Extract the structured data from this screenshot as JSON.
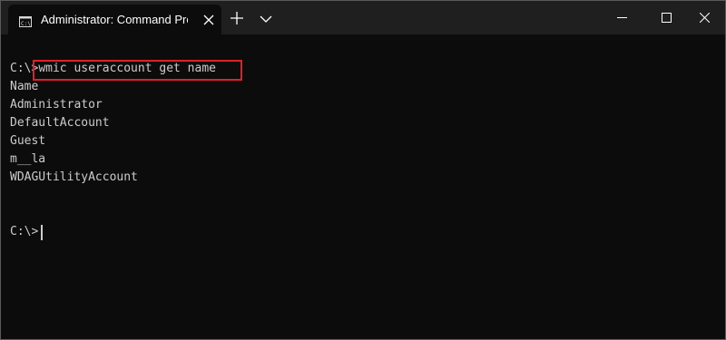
{
  "window": {
    "tab_title": "Administrator: Command Prompt",
    "icons": {
      "tab": "cmd-terminal-icon",
      "close_tab": "close-icon",
      "new_tab": "plus-icon",
      "dropdown": "chevron-down-icon",
      "minimize": "minimize-icon",
      "maximize": "maximize-icon",
      "close_window": "close-icon"
    }
  },
  "terminal": {
    "prompt": "C:\\>",
    "command": "wmic useraccount get name",
    "output_header": "Name",
    "output_rows": [
      "Administrator",
      "DefaultAccount",
      "Guest",
      "m__la",
      "WDAGUtilityAccount"
    ],
    "final_prompt": "C:\\>"
  },
  "colors": {
    "background": "#0c0c0c",
    "titlebar": "#1f1f1f",
    "text": "#cccccc",
    "highlight_border": "#e0202a"
  }
}
